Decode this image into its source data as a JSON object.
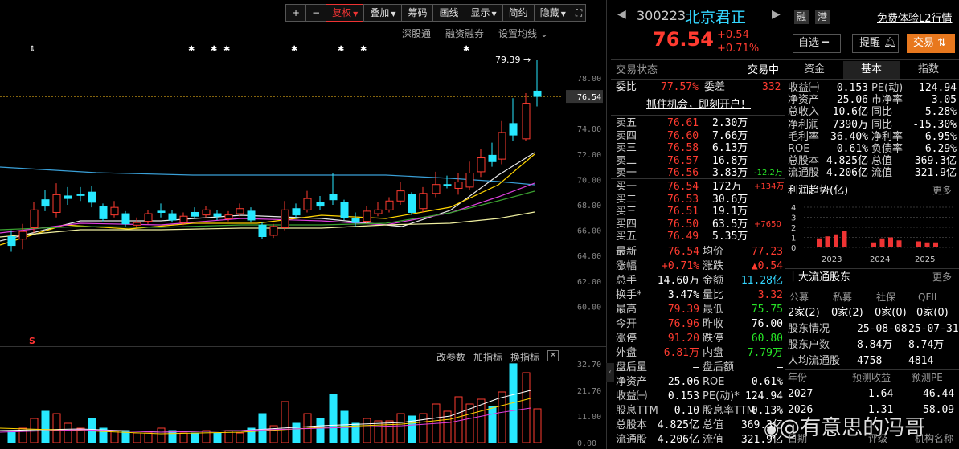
{
  "toolbar": {
    "plus": "+",
    "minus": "−",
    "buttons": [
      "复权",
      "叠加",
      "筹码",
      "画线",
      "显示",
      "简约",
      "隐藏"
    ]
  },
  "subbar": [
    "深股通",
    "融资融券",
    "设置均线"
  ],
  "price_axis": [
    "78.00",
    "76.54",
    "74.00",
    "72.00",
    "70.00",
    "68.00",
    "66.00",
    "64.00",
    "62.00",
    "60.00"
  ],
  "high_label": "79.39",
  "s_marker": "S",
  "vol_tools": [
    "改参数",
    "加指标",
    "换指标"
  ],
  "vol_axis": [
    "32.70",
    "21.70",
    "11.00",
    "0.00"
  ],
  "stock": {
    "code": "300223",
    "name": "北京君正",
    "price": "76.54",
    "change": "+0.54",
    "change_pct": "+0.71%",
    "tag_rong": "融",
    "tag_gang": "港",
    "l2_link": "免费体验L2行情",
    "btn_watch": "自选",
    "btn_remind": "提醒",
    "btn_trade": "交易"
  },
  "status": {
    "label": "交易状态",
    "value": "交易中"
  },
  "weibi": {
    "label1": "委比",
    "value1": "77.57%",
    "label2": "委差",
    "value2": "332"
  },
  "open_account": "抓住机会，即刻开户！",
  "asks": [
    {
      "label": "卖五",
      "price": "76.61",
      "vol": "2.30万",
      "delta": ""
    },
    {
      "label": "卖四",
      "price": "76.60",
      "vol": "7.66万",
      "delta": ""
    },
    {
      "label": "卖三",
      "price": "76.58",
      "vol": "6.13万",
      "delta": ""
    },
    {
      "label": "卖二",
      "price": "76.57",
      "vol": "16.8万",
      "delta": ""
    },
    {
      "label": "卖一",
      "price": "76.56",
      "vol": "3.83万",
      "delta": "-12.2万"
    }
  ],
  "bids": [
    {
      "label": "买一",
      "price": "76.54",
      "vol": "172万",
      "delta": "+134万"
    },
    {
      "label": "买二",
      "price": "76.53",
      "vol": "30.6万",
      "delta": ""
    },
    {
      "label": "买三",
      "price": "76.51",
      "vol": "19.1万",
      "delta": ""
    },
    {
      "label": "买四",
      "price": "76.50",
      "vol": "63.5万",
      "delta": "+7650"
    },
    {
      "label": "买五",
      "price": "76.49",
      "vol": "5.35万",
      "delta": ""
    }
  ],
  "quote": [
    {
      "l": "最新",
      "v": "76.54",
      "c": "red",
      "l2": "均价",
      "v2": "77.23",
      "c2": "red"
    },
    {
      "l": "涨幅",
      "v": "+0.71%",
      "c": "red",
      "l2": "涨跌",
      "v2": "▲0.54",
      "c2": "red"
    },
    {
      "l": "总手",
      "v": "14.60万",
      "c": "white",
      "l2": "金额",
      "v2": "11.28亿",
      "c2": "cyan"
    },
    {
      "l": "换手*",
      "v": "3.47%",
      "c": "white",
      "l2": "量比",
      "v2": "3.32",
      "c2": "red"
    },
    {
      "l": "最高",
      "v": "79.39",
      "c": "red",
      "l2": "最低",
      "v2": "75.75",
      "c2": "green"
    },
    {
      "l": "今开",
      "v": "76.96",
      "c": "red",
      "l2": "昨收",
      "v2": "76.00",
      "c2": "white"
    },
    {
      "l": "涨停",
      "v": "91.20",
      "c": "red",
      "l2": "跌停",
      "v2": "60.80",
      "c2": "green"
    },
    {
      "l": "外盘",
      "v": "6.81万",
      "c": "red",
      "l2": "内盘",
      "v2": "7.79万",
      "c2": "green"
    },
    {
      "l": "盘后量",
      "v": "—",
      "c": "white",
      "l2": "盘后额",
      "v2": "—",
      "c2": "white"
    },
    {
      "l": "净资产",
      "v": "25.06",
      "c": "white",
      "l2": "ROE",
      "v2": "0.61%",
      "c2": "white"
    },
    {
      "l": "收益㈠",
      "v": "0.153",
      "c": "white",
      "l2": "PE(动)*",
      "v2": "124.94",
      "c2": "white"
    },
    {
      "l": "股息TTM",
      "v": "0.10",
      "c": "white",
      "l2": "股息率TTM",
      "v2": "0.13%",
      "c2": "white"
    },
    {
      "l": "总股本",
      "v": "4.825亿",
      "c": "white",
      "l2": "总值",
      "v2": "369.3亿",
      "c2": "white"
    },
    {
      "l": "流通股",
      "v": "4.206亿",
      "c": "white",
      "l2": "流值",
      "v2": "321.9亿",
      "c2": "white"
    }
  ],
  "tabs": [
    "资金",
    "基本",
    "指数"
  ],
  "basics": [
    {
      "l": "收益㈠",
      "v": "0.153",
      "l2": "PE(动)",
      "v2": "124.94"
    },
    {
      "l": "净资产",
      "v": "25.06",
      "l2": "市净率",
      "v2": "3.05"
    },
    {
      "l": "总收入",
      "v": "10.6亿",
      "l2": "同比",
      "v2": "5.28%"
    },
    {
      "l": "净利润",
      "v": "7390万",
      "l2": "同比",
      "v2": "-15.30%"
    },
    {
      "l": "毛利率",
      "v": "36.40%",
      "l2": "净利率",
      "v2": "6.95%"
    },
    {
      "l": "ROE",
      "v": "0.61%",
      "l2": "负债率",
      "v2": "6.29%"
    },
    {
      "l": "总股本",
      "v": "4.825亿",
      "l2": "总值",
      "v2": "369.3亿"
    },
    {
      "l": "流通股",
      "v": "4.206亿",
      "l2": "流值",
      "v2": "321.9亿"
    }
  ],
  "profit": {
    "title": "利润趋势(亿)",
    "more": "更多",
    "y_ticks": [
      "4",
      "3",
      "2",
      "1",
      "0"
    ],
    "x_ticks": [
      "2023",
      "2024",
      "2025"
    ],
    "values": [
      0.9,
      1.1,
      1.3,
      1.6,
      0.5,
      0.9,
      1.0,
      0.7,
      0.6,
      0.5,
      0.5
    ]
  },
  "holders": {
    "title": "十大流通股东",
    "more": "更多",
    "cols": [
      "公募",
      "私募",
      "社保",
      "QFII"
    ],
    "vals": [
      "2家(2)",
      "0家(2)",
      "0家(0)",
      "0家(0)"
    ],
    "rows": [
      {
        "l": "股东情况",
        "a": "25-08-08",
        "b": "25-07-31"
      },
      {
        "l": "股东户数",
        "a": "8.84万",
        "b": "8.74万"
      },
      {
        "l": "人均流通股",
        "a": "4758",
        "b": "4814"
      }
    ]
  },
  "forecast": {
    "cols": [
      "年份",
      "预测收益",
      "预测PE"
    ],
    "rows": [
      {
        "y": "2027",
        "e": "1.64",
        "pe": "46.44"
      },
      {
        "y": "2026",
        "e": "1.31",
        "pe": "58.09"
      }
    ],
    "foot": [
      "日期",
      "评级",
      "机构名称"
    ]
  },
  "watermark": "@有意思的冯哥",
  "colors": {
    "up": "#ff3b30",
    "down": "#27e8ff",
    "bg": "#000000"
  }
}
